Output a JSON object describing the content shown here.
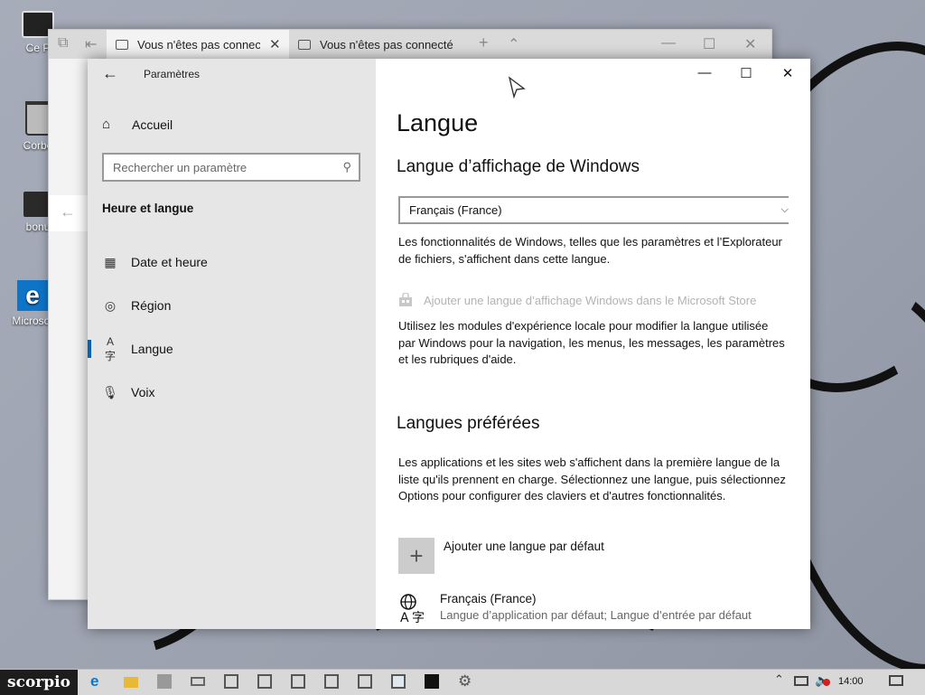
{
  "desktop": {
    "icons": [
      {
        "label": "Ce P"
      },
      {
        "label": "Corbe"
      },
      {
        "label": "bonu"
      },
      {
        "label": "Microsof"
      }
    ]
  },
  "browser": {
    "tabs": [
      {
        "label": "Vous n'êtes pas connect"
      },
      {
        "label": "Vous n'êtes pas connecté"
      }
    ]
  },
  "settings": {
    "app_title": "Paramètres",
    "home_label": "Accueil",
    "search_placeholder": "Rechercher un paramètre",
    "section_title": "Heure et langue",
    "nav_items": [
      {
        "label": "Date et heure",
        "icon": "calendar-clock-icon"
      },
      {
        "label": "Région",
        "icon": "globe-icon"
      },
      {
        "label": "Langue",
        "icon": "language-icon",
        "active": true
      },
      {
        "label": "Voix",
        "icon": "microphone-icon"
      }
    ],
    "content": {
      "page_title": "Langue",
      "display_heading": "Langue d’affichage de Windows",
      "display_value": "Français (France)",
      "display_desc": "Les fonctionnalités de Windows, telles que les paramètres et l’Explorateur de fichiers, s'affichent dans cette langue.",
      "store_link": "Ajouter une langue d’affichage Windows dans le Microsoft Store",
      "store_desc": "Utilisez les modules d'expérience locale pour modifier la langue utilisée par Windows pour la navigation, les menus, les messages, les paramètres et les rubriques d'aide.",
      "preferred_heading": "Langues préférées",
      "preferred_desc": "Les applications et les sites web s'affichent dans la première langue de la liste qu'ils prennent en charge. Sélectionnez une langue, puis sélectionnez Options pour configurer des claviers et d'autres fonctionnalités.",
      "add_language": "Ajouter une langue par défaut",
      "language_name": "Français (France)",
      "language_desc": "Langue d’application par défaut; Langue d’entrée par défaut"
    },
    "accent_color": "#0063b1"
  },
  "taskbar": {
    "start_label": "scorpio",
    "clock": "14:00"
  }
}
